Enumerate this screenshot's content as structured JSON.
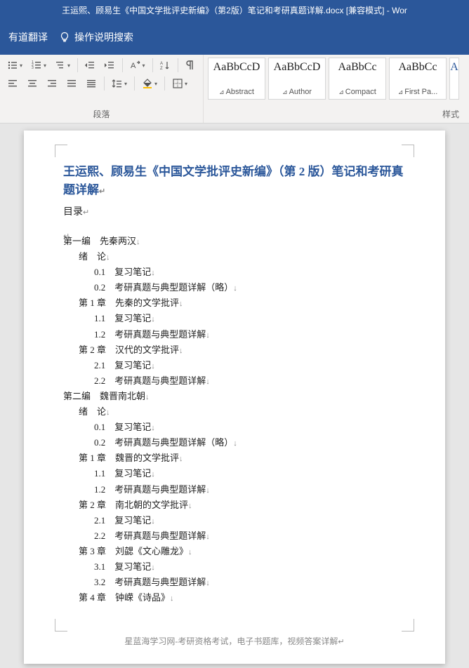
{
  "titlebar": "王运熙、顾易生《中国文学批评史新编》（第2版）笔记和考研真题详解.docx [兼容模式] - Wor",
  "tabs": {
    "translate": "有道翻译",
    "tell_me": "操作说明搜索"
  },
  "ribbon": {
    "paragraph_label": "段落",
    "styles_label": "样式"
  },
  "styles": [
    {
      "sample": "AaBbCcD",
      "name": "Abstract"
    },
    {
      "sample": "AaBbCcD",
      "name": "Author"
    },
    {
      "sample": "AaBbCc",
      "name": "Compact"
    },
    {
      "sample": "AaBbCc",
      "name": "First Pa..."
    }
  ],
  "document": {
    "title": "王运熙、顾易生《中国文学批评史新编》（第 2 版）笔记和考研真题详解",
    "toc_label": "目录",
    "toc": [
      {
        "lvl": 0,
        "text": "第一编　先秦两汉"
      },
      {
        "lvl": 1,
        "text": "绪　论"
      },
      {
        "lvl": 2,
        "text": "0.1　复习笔记"
      },
      {
        "lvl": 2,
        "text": "0.2　考研真题与典型题详解（略）"
      },
      {
        "lvl": 1,
        "text": "第 1 章　先秦的文学批评"
      },
      {
        "lvl": 2,
        "text": "1.1　复习笔记"
      },
      {
        "lvl": 2,
        "text": "1.2　考研真题与典型题详解"
      },
      {
        "lvl": 1,
        "text": "第 2 章　汉代的文学批评"
      },
      {
        "lvl": 2,
        "text": "2.1　复习笔记"
      },
      {
        "lvl": 2,
        "text": "2.2　考研真题与典型题详解"
      },
      {
        "lvl": 0,
        "text": "第二编　魏晋南北朝"
      },
      {
        "lvl": 1,
        "text": "绪　论"
      },
      {
        "lvl": 2,
        "text": "0.1　复习笔记"
      },
      {
        "lvl": 2,
        "text": "0.2　考研真题与典型题详解（略）"
      },
      {
        "lvl": 1,
        "text": "第 1 章　魏晋的文学批评"
      },
      {
        "lvl": 2,
        "text": "1.1　复习笔记"
      },
      {
        "lvl": 2,
        "text": "1.2　考研真题与典型题详解"
      },
      {
        "lvl": 1,
        "text": "第 2 章　南北朝的文学批评"
      },
      {
        "lvl": 2,
        "text": "2.1　复习笔记"
      },
      {
        "lvl": 2,
        "text": "2.2　考研真题与典型题详解"
      },
      {
        "lvl": 1,
        "text": "第 3 章　刘勰《文心雕龙》"
      },
      {
        "lvl": 2,
        "text": "3.1　复习笔记"
      },
      {
        "lvl": 2,
        "text": "3.2　考研真题与典型题详解"
      },
      {
        "lvl": 1,
        "text": "第 4 章　钟嵘《诗品》"
      }
    ],
    "footer": "星蓝海学习网-考研资格考试，电子书题库，视频答案详解"
  }
}
